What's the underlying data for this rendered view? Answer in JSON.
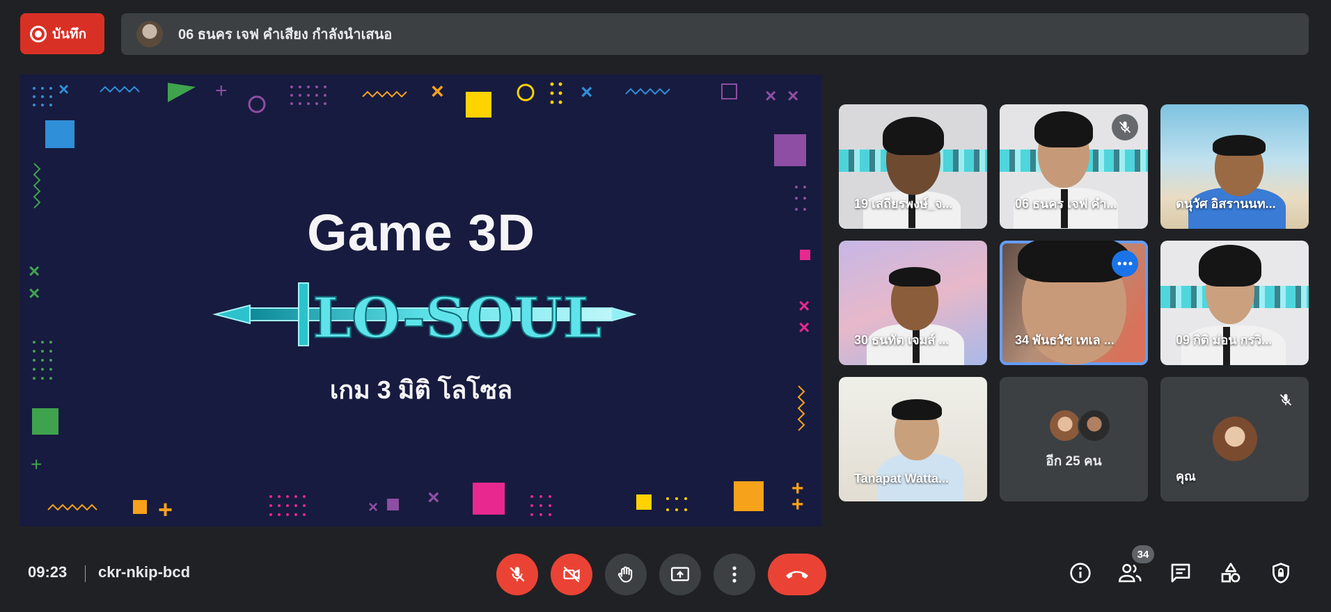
{
  "top": {
    "record_label": "บันทึก",
    "presenter_text": "06 ธนคร เจฟ คำเสียง กำลังนำเสนอ"
  },
  "slide": {
    "title": "Game 3D",
    "logo_text": "LO-SOUL",
    "subtitle": "เกม 3 มิติ โลโซล"
  },
  "participants": [
    {
      "name": "19 เสถียรพงษ์_จ...",
      "muted": false
    },
    {
      "name": "06 ธนคร เจฟ คำ...",
      "muted": true
    },
    {
      "name": "ดนุวัศ อิสรานนท...",
      "muted": false
    },
    {
      "name": "30 ธนทัต เจมส์ ...",
      "muted": false
    },
    {
      "name": "34 พันธวัช เทเล ...",
      "muted": false,
      "active_speaker": true
    },
    {
      "name": "09 กิติ ม่อน กรวิ...",
      "muted": false
    },
    {
      "name": "Tanapat Watta...",
      "muted": false
    },
    {
      "name": "",
      "more_label": "อีก 25 คน"
    },
    {
      "name": "คุณ",
      "muted": true
    }
  ],
  "bottom": {
    "time": "09:23",
    "meeting_code": "ckr-nkip-bcd",
    "participant_count": "34",
    "controls": [
      "mic-off-icon",
      "camera-off-icon",
      "raise-hand-icon",
      "present-screen-icon",
      "more-options-icon",
      "end-call-icon"
    ],
    "right_icons": [
      "info-icon",
      "people-icon",
      "chat-icon",
      "activities-icon",
      "host-controls-icon"
    ]
  },
  "colors": {
    "background": "#202124",
    "record": "#d93025",
    "end_call": "#ea4335",
    "active_outline": "#669df6",
    "slide_bg": "#171b3f"
  }
}
